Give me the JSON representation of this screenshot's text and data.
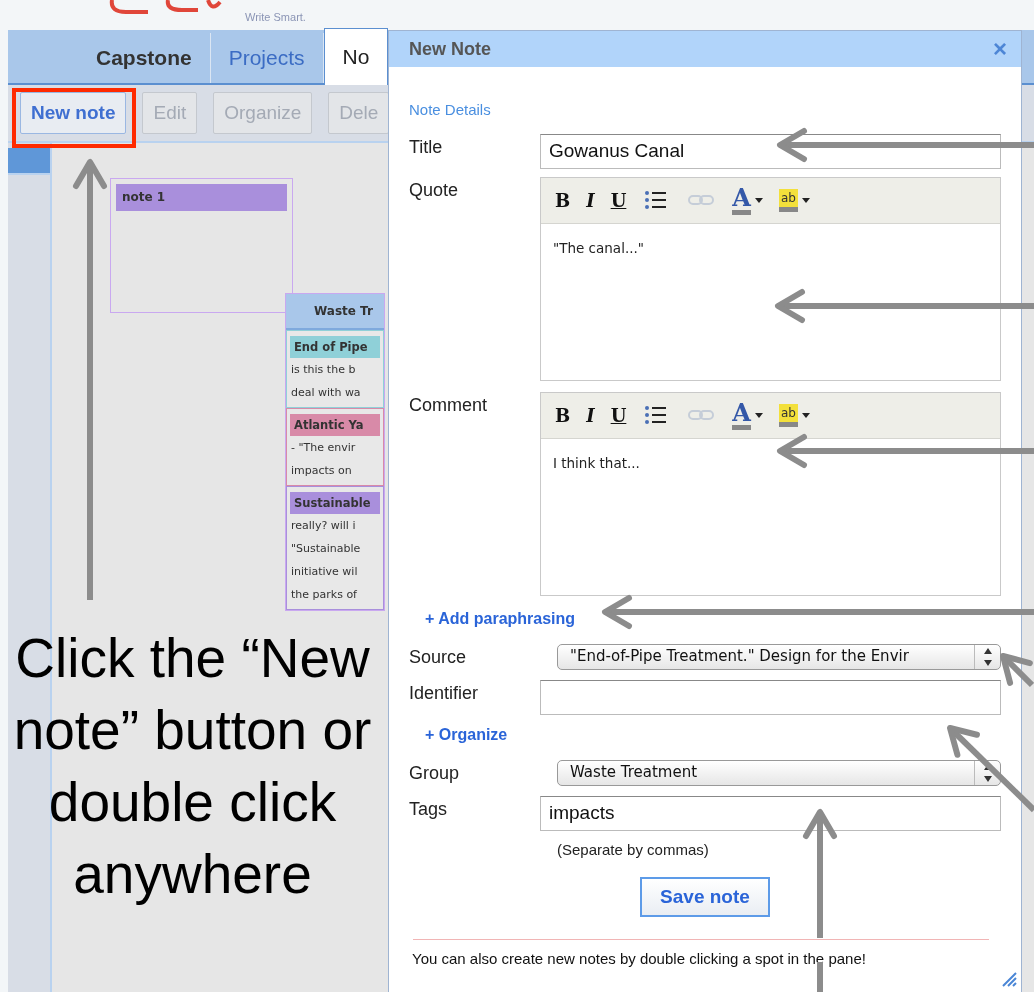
{
  "app": {
    "logo_tagline": "Write Smart.",
    "tabs": [
      {
        "label": "Capstone",
        "selected": false
      },
      {
        "label": "Projects",
        "selected": false
      },
      {
        "label": "No",
        "selected": true
      }
    ],
    "toolbar": [
      {
        "label": "New note",
        "disabled": false,
        "highlighted": true
      },
      {
        "label": "Edit",
        "disabled": true,
        "highlighted": false
      },
      {
        "label": "Organize",
        "disabled": true,
        "highlighted": false
      },
      {
        "label": "Dele",
        "disabled": true,
        "highlighted": false
      }
    ],
    "sidebar": {
      "items": [
        {
          "selected": true
        }
      ]
    },
    "canvas": {
      "notes": [
        {
          "title": "note 1",
          "color": "#a98fdc"
        }
      ],
      "groups": [
        {
          "title": "Waste Tr",
          "notes": [
            {
              "title": "End of Pipe",
              "color": "#8fd0d8",
              "lines": [
                "is this the b",
                "deal with wa"
              ]
            },
            {
              "title": "Atlantic Ya",
              "color": "#d88aa8",
              "lines": [
                "- \"The envir",
                "impacts on"
              ]
            },
            {
              "title": "Sustainable",
              "color": "#a98fdc",
              "lines": [
                "really? will i",
                "\"Sustainable",
                "initiative wil",
                "the parks of"
              ]
            }
          ]
        }
      ]
    }
  },
  "dialog": {
    "title": "New Note",
    "close": "×",
    "section": "Note Details",
    "rows": [
      {
        "kind": "text",
        "label": "Title",
        "value": "Gowanus Canal"
      },
      {
        "kind": "editor",
        "label": "Quote",
        "value": "\"The canal...\"",
        "buttons": [
          {
            "kind": "bold",
            "label": "B"
          },
          {
            "kind": "italic",
            "label": "I"
          },
          {
            "kind": "underline",
            "label": "U"
          },
          {
            "kind": "list"
          },
          {
            "kind": "link",
            "disabled": true
          },
          {
            "kind": "font_color",
            "label": "A"
          },
          {
            "kind": "highlight",
            "label": "ab"
          }
        ]
      },
      {
        "kind": "editor",
        "label": "Comment",
        "value": "I think that...",
        "buttons": [
          {
            "kind": "bold",
            "label": "B"
          },
          {
            "kind": "italic",
            "label": "I"
          },
          {
            "kind": "underline",
            "label": "U"
          },
          {
            "kind": "list"
          },
          {
            "kind": "link",
            "disabled": true
          },
          {
            "kind": "font_color",
            "label": "A"
          },
          {
            "kind": "highlight",
            "label": "ab"
          }
        ]
      },
      {
        "kind": "link",
        "label": "+ Add paraphrasing"
      },
      {
        "kind": "select",
        "label": "Source",
        "value": "\"End-of-Pipe Treatment.\" Design for the Envir"
      },
      {
        "kind": "text",
        "label": "Identifier"
      },
      {
        "kind": "link",
        "label": "+ Organize"
      },
      {
        "kind": "select",
        "label": "Group",
        "value": "Waste Treatment"
      },
      {
        "kind": "text",
        "label": "Tags",
        "value": "impacts",
        "help": "(Separate by commas)"
      }
    ],
    "save_button": "Save note",
    "footer": "You can also create new notes by double clicking a spot in the pane!"
  },
  "annotation": {
    "text": "Click the “New note” button or double click anywhere"
  }
}
